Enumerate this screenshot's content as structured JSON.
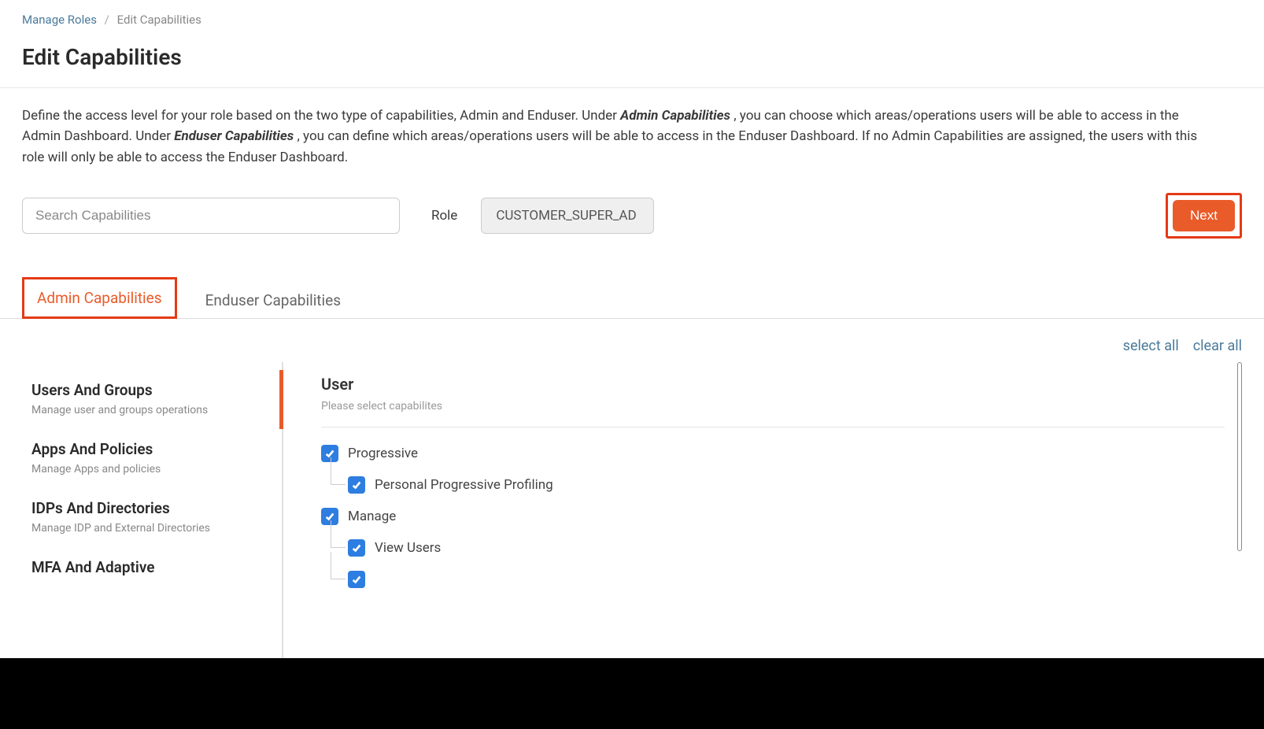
{
  "breadcrumb": {
    "parent": "Manage Roles",
    "current": "Edit Capabilities"
  },
  "page_title": "Edit Capabilities",
  "description": {
    "pre": "Define the access level for your role based on the two type of capabilities, Admin and Enduser. Under ",
    "bold1": "Admin Capabilities",
    "mid1": ", you can choose which areas/operations users will be able to access in the Admin Dashboard. Under ",
    "bold2": "Enduser Capabilities",
    "post": ", you can define which areas/operations users will be able to access in the Enduser Dashboard. If no Admin Capabilities are assigned, the users with this role will only be able to access the Enduser Dashboard."
  },
  "search": {
    "placeholder": "Search Capabilities",
    "value": ""
  },
  "role": {
    "label": "Role",
    "value": "CUSTOMER_SUPER_AD"
  },
  "next_label": "Next",
  "tabs": [
    {
      "label": "Admin Capabilities",
      "active": true
    },
    {
      "label": "Enduser Capabilities",
      "active": false
    }
  ],
  "actions": {
    "select_all": "select all",
    "clear_all": "clear all"
  },
  "sidebar": {
    "items": [
      {
        "title": "Users And Groups",
        "desc": "Manage user and groups operations",
        "active": true
      },
      {
        "title": "Apps And Policies",
        "desc": "Manage Apps and policies",
        "active": false
      },
      {
        "title": "IDPs And Directories",
        "desc": "Manage IDP and External Directories",
        "active": false
      },
      {
        "title": "MFA And Adaptive",
        "desc": "",
        "active": false
      }
    ]
  },
  "detail": {
    "section_title": "User",
    "section_sub": "Please select capabilites",
    "caps": [
      {
        "label": "Progressive",
        "checked": true,
        "children": [
          {
            "label": "Personal Progressive Profiling",
            "checked": true
          }
        ]
      },
      {
        "label": "Manage",
        "checked": true,
        "children": [
          {
            "label": "View Users",
            "checked": true
          }
        ]
      }
    ]
  }
}
